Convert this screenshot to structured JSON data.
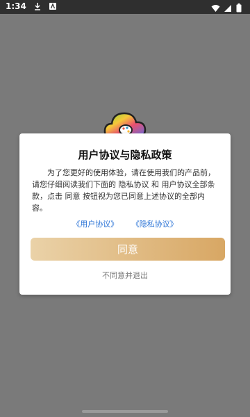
{
  "status_bar": {
    "time": "1:34",
    "icons": [
      "download-icon",
      "app-notification-icon",
      "wifi-icon",
      "signal-icon",
      "battery-icon"
    ]
  },
  "app": {
    "logo_icon": "cloud-palette-logo"
  },
  "dialog": {
    "title": "用户协议与隐私政策",
    "body": "为了您更好的使用体验，请在使用我们的产品前，请您仔细阅读我们下面的 隐私协议 和 用户协议全部条款，点击 同意 按钮视为您已同意上述协议的全部内容。",
    "links": {
      "user_agreement": "《用户协议》",
      "privacy_agreement": "《隐私协议》"
    },
    "agree_button": "同意",
    "disagree_link": "不同意并退出"
  },
  "colors": {
    "accent_gold_start": "#ead2a8",
    "accent_gold_end": "#d8a764",
    "link_blue": "#2a73d6",
    "overlay_gray": "#7a7a7a"
  }
}
